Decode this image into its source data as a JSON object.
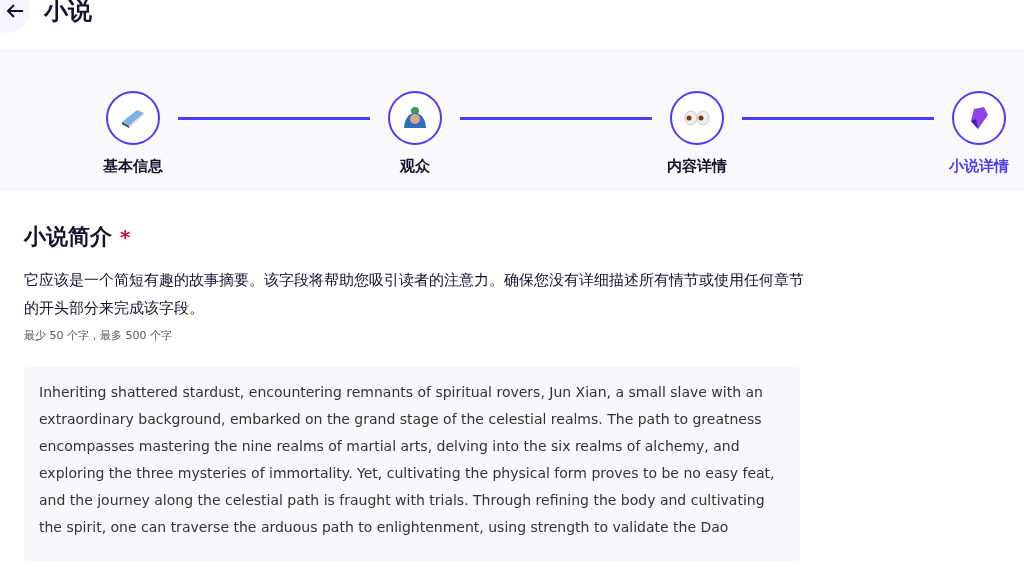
{
  "header": {
    "title": "小说"
  },
  "steps": [
    {
      "label": "基本信息",
      "selected": false
    },
    {
      "label": "观众",
      "selected": false
    },
    {
      "label": "内容详情",
      "selected": false
    },
    {
      "label": "小说详情",
      "selected": true
    }
  ],
  "section": {
    "title": "小说简介",
    "required_mark": "*",
    "description": "它应该是一个简短有趣的故事摘要。该字段将帮助您吸引读者的注意力。确保您没有详细描述所有情节或使用任何章节的开头部分来完成该字段。",
    "hint": "最少 50 个字，最多 500 个字",
    "value": "Inheriting shattered stardust, encountering remnants of spiritual rovers, Jun Xian, a small slave with an extraordinary background, embarked on the grand stage of the celestial realms. The path to greatness encompasses mastering the nine realms of martial arts, delving into the six realms of alchemy, and exploring the three mysteries of immortality. Yet, cultivating the physical form proves to be no easy feat, and the journey along the celestial path is fraught with trials. Through refining the body and cultivating the spirit, one can traverse the arduous path to enlightenment, using strength to validate the Dao"
  }
}
